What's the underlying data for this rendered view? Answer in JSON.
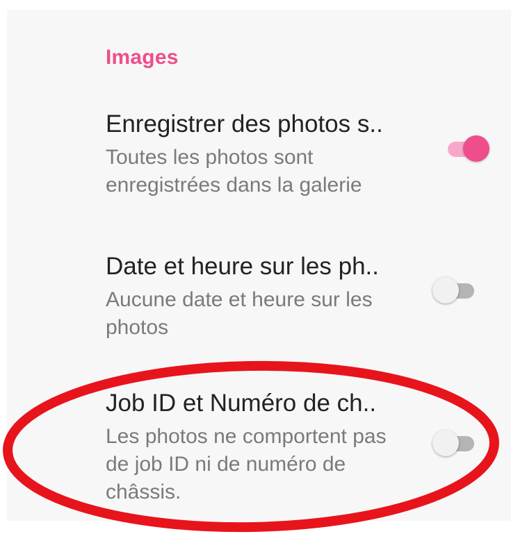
{
  "colors": {
    "accent": "#ef4d8b",
    "accent_track": "#f7a8c8",
    "title_text": "#222222",
    "summary_text": "#7a7a7a",
    "annotation_ring": "#e8141b"
  },
  "section": {
    "title": "Images"
  },
  "settings": [
    {
      "title": "Enregistrer des photos s..",
      "summary": "Toutes les photos sont enregistrées dans la galerie",
      "enabled": true
    },
    {
      "title": "Date et heure sur les ph..",
      "summary": "Aucune date et heure sur les photos",
      "enabled": false
    },
    {
      "title": "Job ID et Numéro de ch..",
      "summary": "Les photos ne comportent pas de job ID ni de numéro de châssis.",
      "enabled": false
    }
  ]
}
